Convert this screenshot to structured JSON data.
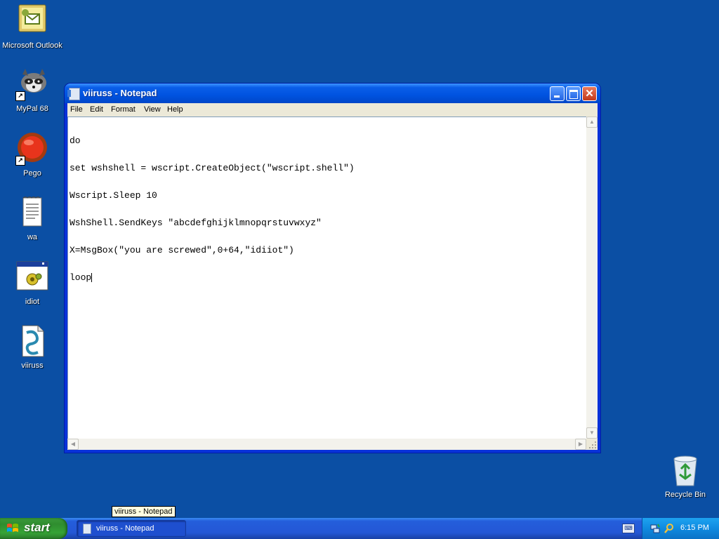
{
  "desktop": {
    "icons": [
      {
        "label": "Microsoft Outlook"
      },
      {
        "label": "MyPal 68"
      },
      {
        "label": "Pego"
      },
      {
        "label": "wa"
      },
      {
        "label": "idiot"
      },
      {
        "label": "viiruss"
      }
    ],
    "recycle_bin": {
      "label": "Recycle Bin"
    }
  },
  "notepad": {
    "title": "viiruss - Notepad",
    "menu": [
      "File",
      "Edit",
      "Format",
      "View",
      "Help"
    ],
    "lines": [
      "do",
      "set wshshell = wscript.CreateObject(\"wscript.shell\")",
      "Wscript.Sleep 10",
      "WshShell.SendKeys \"abcdefghijklmnopqrstuvwxyz\"",
      "X=MsgBox(\"you are screwed\",0+64,\"idiiot\")",
      "loop"
    ]
  },
  "taskbar": {
    "start_label": "start",
    "task_button_label": "viiruss - Notepad",
    "tooltip": "viiruss - Notepad",
    "clock": "6:15 PM"
  },
  "colors": {
    "desktop": "#0b4fa4",
    "titlebar": "#0053e0",
    "start_green": "#36a336"
  }
}
